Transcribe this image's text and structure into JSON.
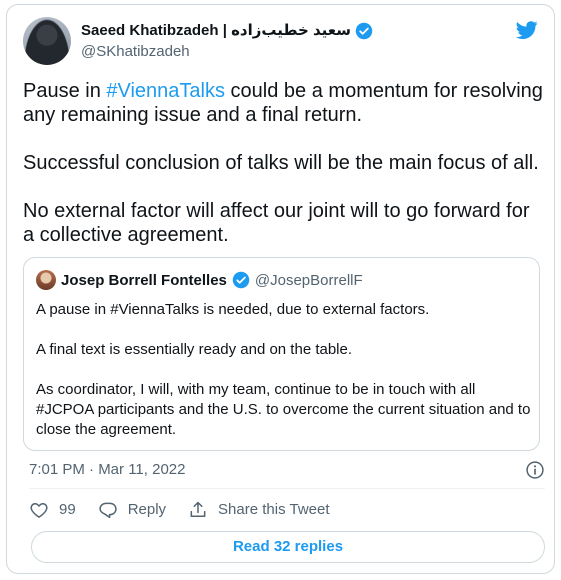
{
  "author": {
    "name": "Saeed Khatibzadeh | سعید خطیب‌زاده",
    "handle": "@SKhatibzadeh"
  },
  "tweet": {
    "line1_prefix": "Pause in ",
    "line1_hashtag": "#ViennaTalks",
    "line1_suffix": " could be a momentum for resolving any remaining issue and a final return.",
    "paragraph2": "Successful conclusion of talks will be the main focus of all.",
    "paragraph3": "No external factor will affect our joint will to go forward for a collective agreement."
  },
  "quoted": {
    "name": "Josep Borrell Fontelles",
    "handle": "@JosepBorrellF",
    "paragraph1": "A pause in #ViennaTalks is needed, due to external factors.",
    "paragraph2": "A final text is essentially ready and on the table.",
    "paragraph3": "As coordinator, I will, with my team, continue to be in touch with all #JCPOA participants and the U.S. to overcome the current situation and to close the agreement."
  },
  "meta": {
    "timestamp": "7:01 PM · Mar 11, 2022"
  },
  "actions": {
    "like_count": "99",
    "reply_label": "Reply",
    "share_label": "Share this Tweet"
  },
  "replies_button": "Read 32 replies",
  "colors": {
    "accent": "#1d9bf0",
    "text": "#0f1419",
    "secondary": "#536471",
    "border": "#cfd9de"
  },
  "icons": [
    "verified-badge-icon",
    "twitter-logo-icon",
    "info-icon",
    "heart-icon",
    "reply-icon",
    "share-icon"
  ]
}
